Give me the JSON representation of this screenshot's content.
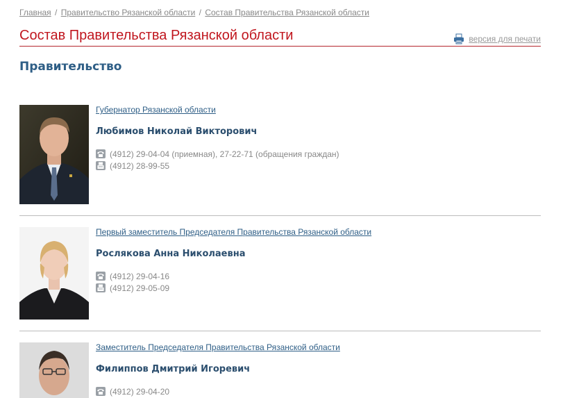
{
  "breadcrumb": {
    "items": [
      "Главная",
      "Правительство Рязанской области",
      "Состав Правительства Рязанской области"
    ],
    "separator": "/"
  },
  "header": {
    "title": "Состав Правительства Рязанской области",
    "print_label": "версия для печати"
  },
  "section": {
    "title": "Правительство"
  },
  "people": [
    {
      "position": "Губернатор Рязанской области",
      "name": "Любимов Николай Викторович",
      "phone": "(4912) 29-04-04 (приемная), 27-22-71 (обращения граждан)",
      "fax": "(4912) 28-99-55"
    },
    {
      "position": "Первый заместитель Председателя Правительства Рязанской области",
      "name": "Рослякова Анна Николаевна",
      "phone": "(4912) 29-04-16",
      "fax": "(4912) 29-05-09"
    },
    {
      "position": "Заместитель Председателя Правительства Рязанской области",
      "name": "Филиппов Дмитрий Игоревич",
      "phone": "(4912) 29-04-20"
    }
  ],
  "colors": {
    "title_red": "#c0161e",
    "link_blue": "#2e5e86",
    "name_blue": "#2b4e6e",
    "muted_gray": "#888888"
  },
  "icons": {
    "print": "printer-icon",
    "phone": "phone-icon",
    "fax": "fax-icon"
  }
}
